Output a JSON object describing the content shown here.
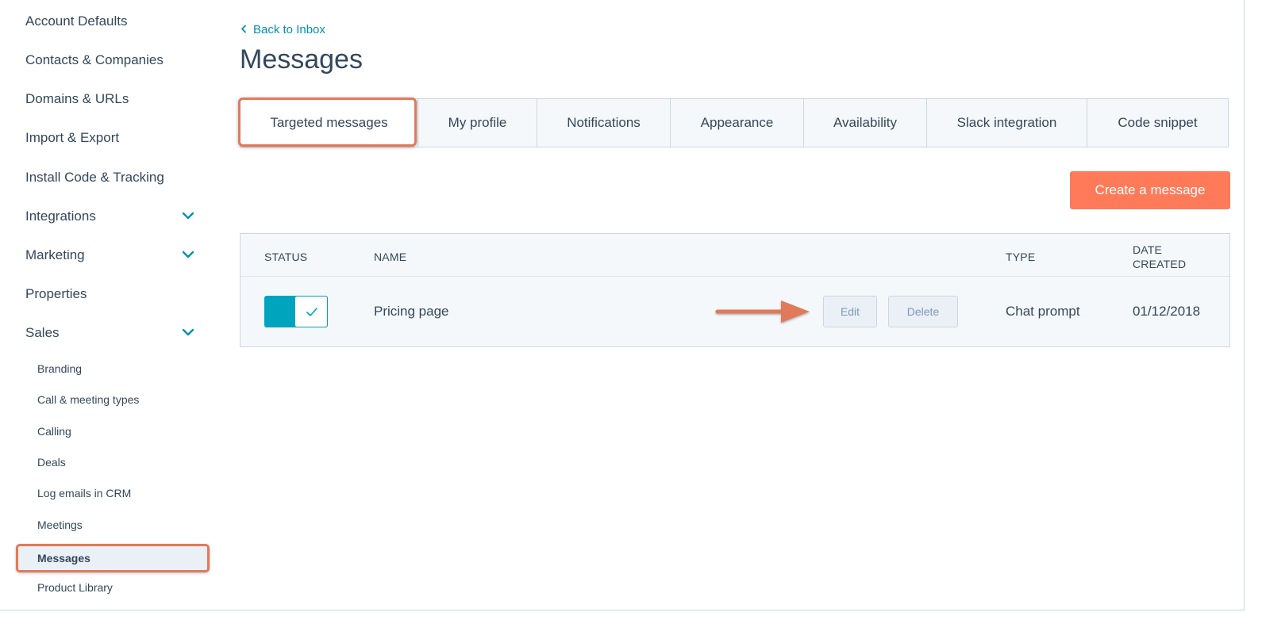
{
  "sidebar": {
    "items": [
      {
        "label": "Account Defaults",
        "expandable": false
      },
      {
        "label": "Contacts & Companies",
        "expandable": false
      },
      {
        "label": "Domains & URLs",
        "expandable": false
      },
      {
        "label": "Import & Export",
        "expandable": false
      },
      {
        "label": "Install Code & Tracking",
        "expandable": false
      },
      {
        "label": "Integrations",
        "expandable": true
      },
      {
        "label": "Marketing",
        "expandable": true
      },
      {
        "label": "Properties",
        "expandable": false
      },
      {
        "label": "Sales",
        "expandable": true
      }
    ],
    "sales_subitems": [
      "Branding",
      "Call & meeting types",
      "Calling",
      "Deals",
      "Log emails in CRM",
      "Meetings",
      "Messages",
      "Product Library"
    ],
    "active_subitem": "Messages"
  },
  "header": {
    "back_link": "Back to Inbox",
    "title": "Messages"
  },
  "tabs": [
    {
      "label": "Targeted messages",
      "active": true
    },
    {
      "label": "My profile",
      "active": false
    },
    {
      "label": "Notifications",
      "active": false
    },
    {
      "label": "Appearance",
      "active": false
    },
    {
      "label": "Availability",
      "active": false
    },
    {
      "label": "Slack integration",
      "active": false
    },
    {
      "label": "Code snippet",
      "active": false
    }
  ],
  "create_button": "Create a message",
  "table": {
    "headers": {
      "status": "STATUS",
      "name": "NAME",
      "type": "TYPE",
      "date_line1": "DATE",
      "date_line2": "CREATED"
    },
    "rows": [
      {
        "status_on": true,
        "name": "Pricing page",
        "edit_label": "Edit",
        "delete_label": "Delete",
        "type": "Chat prompt",
        "date_created": "01/12/2018"
      }
    ]
  },
  "colors": {
    "accent_teal": "#00a4bd",
    "link": "#0091ae",
    "primary_button": "#ff7a59",
    "annotation": "#e07a5a",
    "text": "#33475b"
  },
  "icons": {
    "chevron_down": "chevron-down-icon",
    "chevron_left": "chevron-left-icon",
    "check": "check-icon",
    "annotation_arrow": "arrow-right-icon"
  }
}
